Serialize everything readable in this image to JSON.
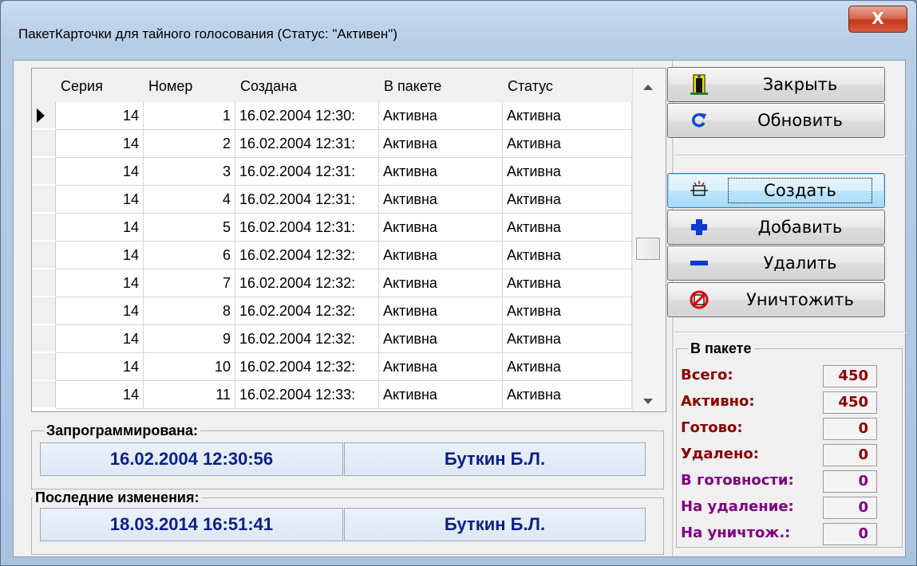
{
  "window": {
    "title": "ПакетКарточки для тайного голосования (Статус: \"Активен\")",
    "close_label": "X"
  },
  "grid": {
    "columns": [
      "Серия",
      "Номер",
      "Создана",
      "В пакете",
      "Статус"
    ],
    "rows": [
      {
        "series": "14",
        "number": "1",
        "created": "16.02.2004 12:30:",
        "in_package": "Активна",
        "status": "Активна",
        "current": true
      },
      {
        "series": "14",
        "number": "2",
        "created": "16.02.2004 12:31:",
        "in_package": "Активна",
        "status": "Активна",
        "current": false
      },
      {
        "series": "14",
        "number": "3",
        "created": "16.02.2004 12:31:",
        "in_package": "Активна",
        "status": "Активна",
        "current": false
      },
      {
        "series": "14",
        "number": "4",
        "created": "16.02.2004 12:31:",
        "in_package": "Активна",
        "status": "Активна",
        "current": false
      },
      {
        "series": "14",
        "number": "5",
        "created": "16.02.2004 12:31:",
        "in_package": "Активна",
        "status": "Активна",
        "current": false
      },
      {
        "series": "14",
        "number": "6",
        "created": "16.02.2004 12:32:",
        "in_package": "Активна",
        "status": "Активна",
        "current": false
      },
      {
        "series": "14",
        "number": "7",
        "created": "16.02.2004 12:32:",
        "in_package": "Активна",
        "status": "Активна",
        "current": false
      },
      {
        "series": "14",
        "number": "8",
        "created": "16.02.2004 12:32:",
        "in_package": "Активна",
        "status": "Активна",
        "current": false
      },
      {
        "series": "14",
        "number": "9",
        "created": "16.02.2004 12:32:",
        "in_package": "Активна",
        "status": "Активна",
        "current": false
      },
      {
        "series": "14",
        "number": "10",
        "created": "16.02.2004 12:32:",
        "in_package": "Активна",
        "status": "Активна",
        "current": false
      },
      {
        "series": "14",
        "number": "11",
        "created": "16.02.2004 12:33:",
        "in_package": "Активна",
        "status": "Активна",
        "current": false
      }
    ]
  },
  "programmed": {
    "label": "Запрограммирована:",
    "date": "16.02.2004 12:30:56",
    "user": "Буткин Б.Л."
  },
  "last_changes": {
    "label": "Последние изменения:",
    "date": "18.03.2014 16:51:41",
    "user": "Буткин Б.Л."
  },
  "buttons": {
    "close": "Закрыть",
    "refresh": "Обновить",
    "create": "Создать",
    "add": "Добавить",
    "remove": "Удалить",
    "destroy": "Уничтожить"
  },
  "stats": {
    "title": "В пакете",
    "items": [
      {
        "label": "Всего:",
        "value": "450",
        "color": "#8b0000"
      },
      {
        "label": "Активно:",
        "value": "450",
        "color": "#8b0000"
      },
      {
        "label": "Готово:",
        "value": "0",
        "color": "#8b0000"
      },
      {
        "label": "Удалено:",
        "value": "0",
        "color": "#8b0000"
      },
      {
        "label": "В готовности:",
        "value": "0",
        "color": "#800080"
      },
      {
        "label": "На удаление:",
        "value": "0",
        "color": "#800080"
      },
      {
        "label": "На уничтож.:",
        "value": "0",
        "color": "#800080"
      }
    ]
  },
  "icons": {
    "close": "door-exit-icon",
    "refresh": "refresh-icon",
    "create": "create-icon",
    "add": "plus-icon",
    "remove": "minus-icon",
    "destroy": "prohibited-icon"
  }
}
